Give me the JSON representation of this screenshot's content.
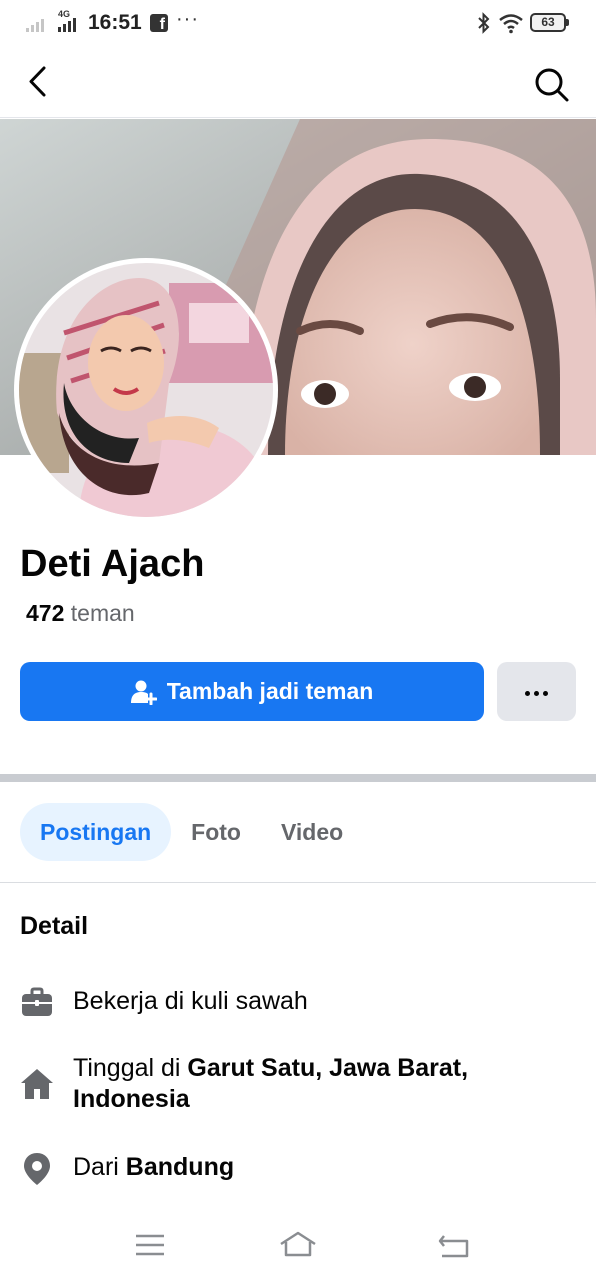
{
  "status_bar": {
    "network": "4G",
    "time": "16:51",
    "more": "···",
    "battery": "63"
  },
  "profile": {
    "name": "Deti Ajach",
    "friends_count": "472",
    "friends_label": "teman"
  },
  "actions": {
    "add_friend_label": "Tambah jadi teman"
  },
  "tabs": [
    {
      "label": "Postingan",
      "active": true
    },
    {
      "label": "Foto",
      "active": false
    },
    {
      "label": "Video",
      "active": false
    }
  ],
  "detail": {
    "title": "Detail",
    "work": "Bekerja di kuli sawah",
    "lives_prefix": "Tinggal di ",
    "lives_place": "Garut Satu, Jawa Barat, Indonesia",
    "from_prefix": "Dari ",
    "from_place": "Bandung"
  },
  "colors": {
    "accent": "#1877f2",
    "tab_active_bg": "#e7f3ff",
    "secondary_button": "#e4e6eb",
    "muted_text": "#65676b"
  },
  "icons": {
    "back": "chevron-left-icon",
    "search": "search-icon",
    "add_friend": "person-add-icon",
    "more": "ellipsis-icon",
    "work": "briefcase-icon",
    "home": "home-icon",
    "location": "location-pin-icon",
    "nav_menu": "menu-icon",
    "nav_home": "home-outline-icon",
    "nav_back": "return-icon"
  }
}
